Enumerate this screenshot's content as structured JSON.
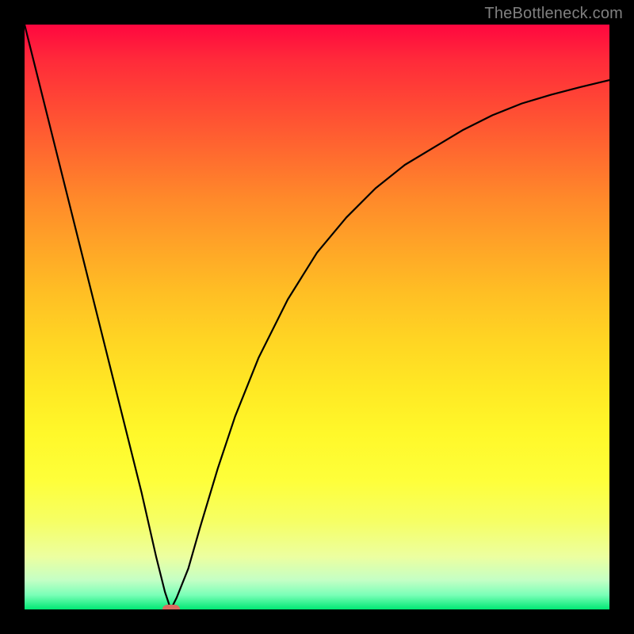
{
  "watermark": "TheBottleneck.com",
  "chart_data": {
    "type": "line",
    "title": "",
    "xlabel": "",
    "ylabel": "",
    "xlim": [
      0,
      100
    ],
    "ylim": [
      0,
      100
    ],
    "grid": false,
    "legend": false,
    "series": [
      {
        "name": "bottleneck-curve",
        "x": [
          0,
          5,
          10,
          15,
          20,
          22.5,
          24,
          25,
          26,
          28,
          30,
          33,
          36,
          40,
          45,
          50,
          55,
          60,
          65,
          70,
          75,
          80,
          85,
          90,
          95,
          100
        ],
        "values": [
          100,
          80,
          60,
          40,
          20,
          9,
          3,
          0,
          2,
          7,
          14,
          24,
          33,
          43,
          53,
          61,
          67,
          72,
          76,
          79,
          82,
          84.5,
          86.5,
          88,
          89.3,
          90.5
        ]
      }
    ],
    "annotations": [
      {
        "name": "optimum-marker",
        "x": 25,
        "y": 0
      }
    ],
    "background": "heat-gradient-red-to-green"
  }
}
